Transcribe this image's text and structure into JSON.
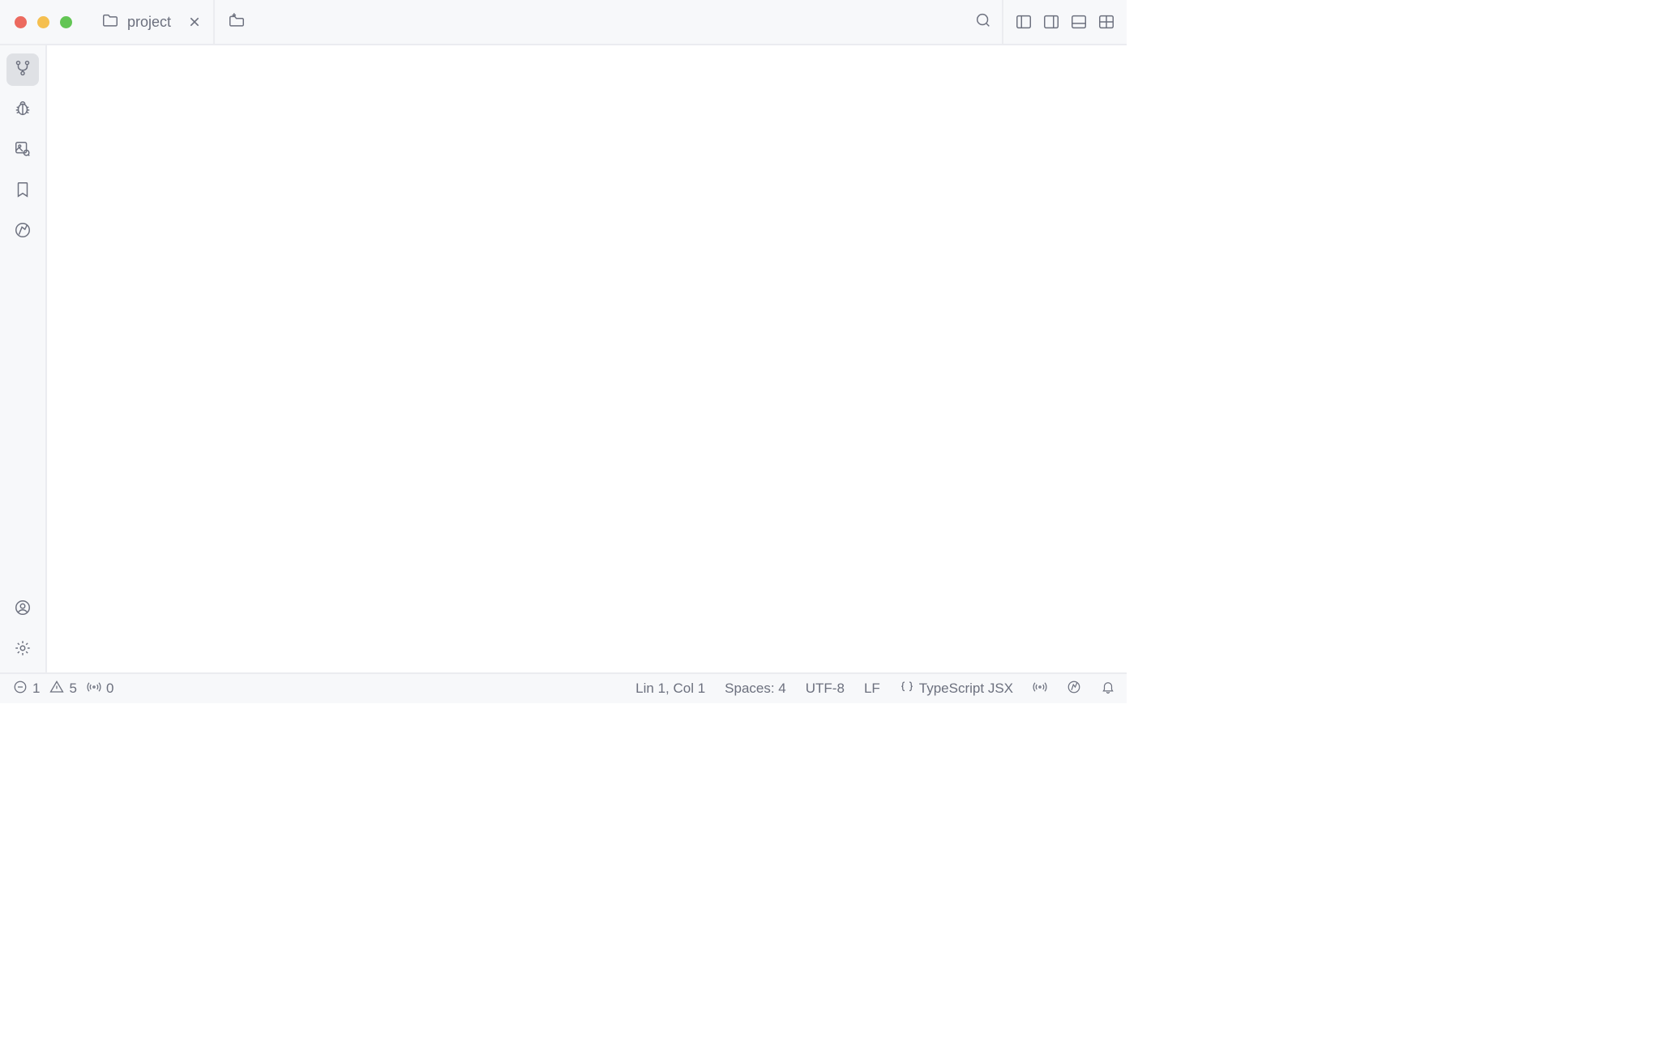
{
  "header": {
    "project_label": "project"
  },
  "statusbar": {
    "errors": "1",
    "warnings": "5",
    "broadcasts": "0",
    "cursor": "Lin 1, Col 1",
    "indent": "Spaces: 4",
    "encoding": "UTF-8",
    "line_ending": "LF",
    "language": "TypeScript JSX"
  }
}
